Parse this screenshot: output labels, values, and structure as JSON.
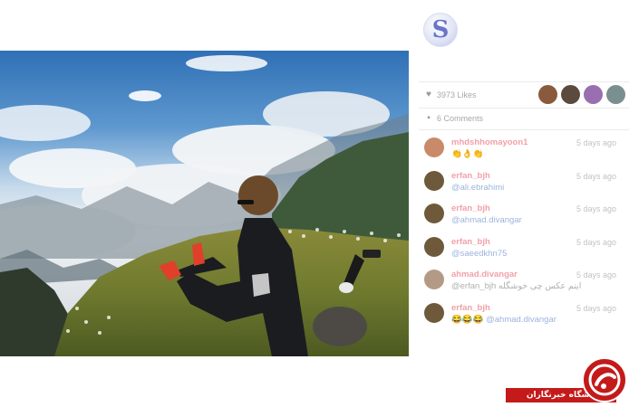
{
  "profile": {
    "avatar_letter": "S",
    "avatar_color": "#6a74c9"
  },
  "likes": {
    "icon": "heart-icon",
    "text": "3973 Likes",
    "avatars": [
      {
        "color": "#8a5a3c"
      },
      {
        "color": "#5d4a3e"
      },
      {
        "color": "#9a6fb0"
      },
      {
        "color": "#7a9090"
      }
    ]
  },
  "comments_header": {
    "icon": "comment-icon",
    "text": "6 Comments"
  },
  "comments": [
    {
      "user": "mhdshhomayoon1",
      "text": "👏👌👏",
      "time": "5 days ago",
      "avatar_color": "#c98a6a",
      "text_plain": true
    },
    {
      "user": "erfan_bjh",
      "text": "@ali.ebrahimi",
      "time": "5 days ago",
      "avatar_color": "#6e5a3a",
      "text_plain": false
    },
    {
      "user": "erfan_bjh",
      "text": "@ahmad.divangar",
      "time": "5 days ago",
      "avatar_color": "#6e5a3a",
      "text_plain": false
    },
    {
      "user": "erfan_bjh",
      "text": "@saeedkhn75",
      "time": "5 days ago",
      "avatar_color": "#6e5a3a",
      "text_plain": false
    },
    {
      "user": "ahmad.divangar",
      "text": "@erfan_bjh اینم عکس چی خوشگله",
      "time": "5 days ago",
      "avatar_color": "#b49a86",
      "text_plain": true
    },
    {
      "user": "erfan_bjh",
      "text": "😂😂😂 @ahmad.divangar",
      "time": "5 days ago",
      "avatar_color": "#6e5a3a",
      "text_plain": false
    }
  ],
  "watermark": {
    "text": "باشگاه خبرنگاران",
    "color": "#c41a1a"
  }
}
